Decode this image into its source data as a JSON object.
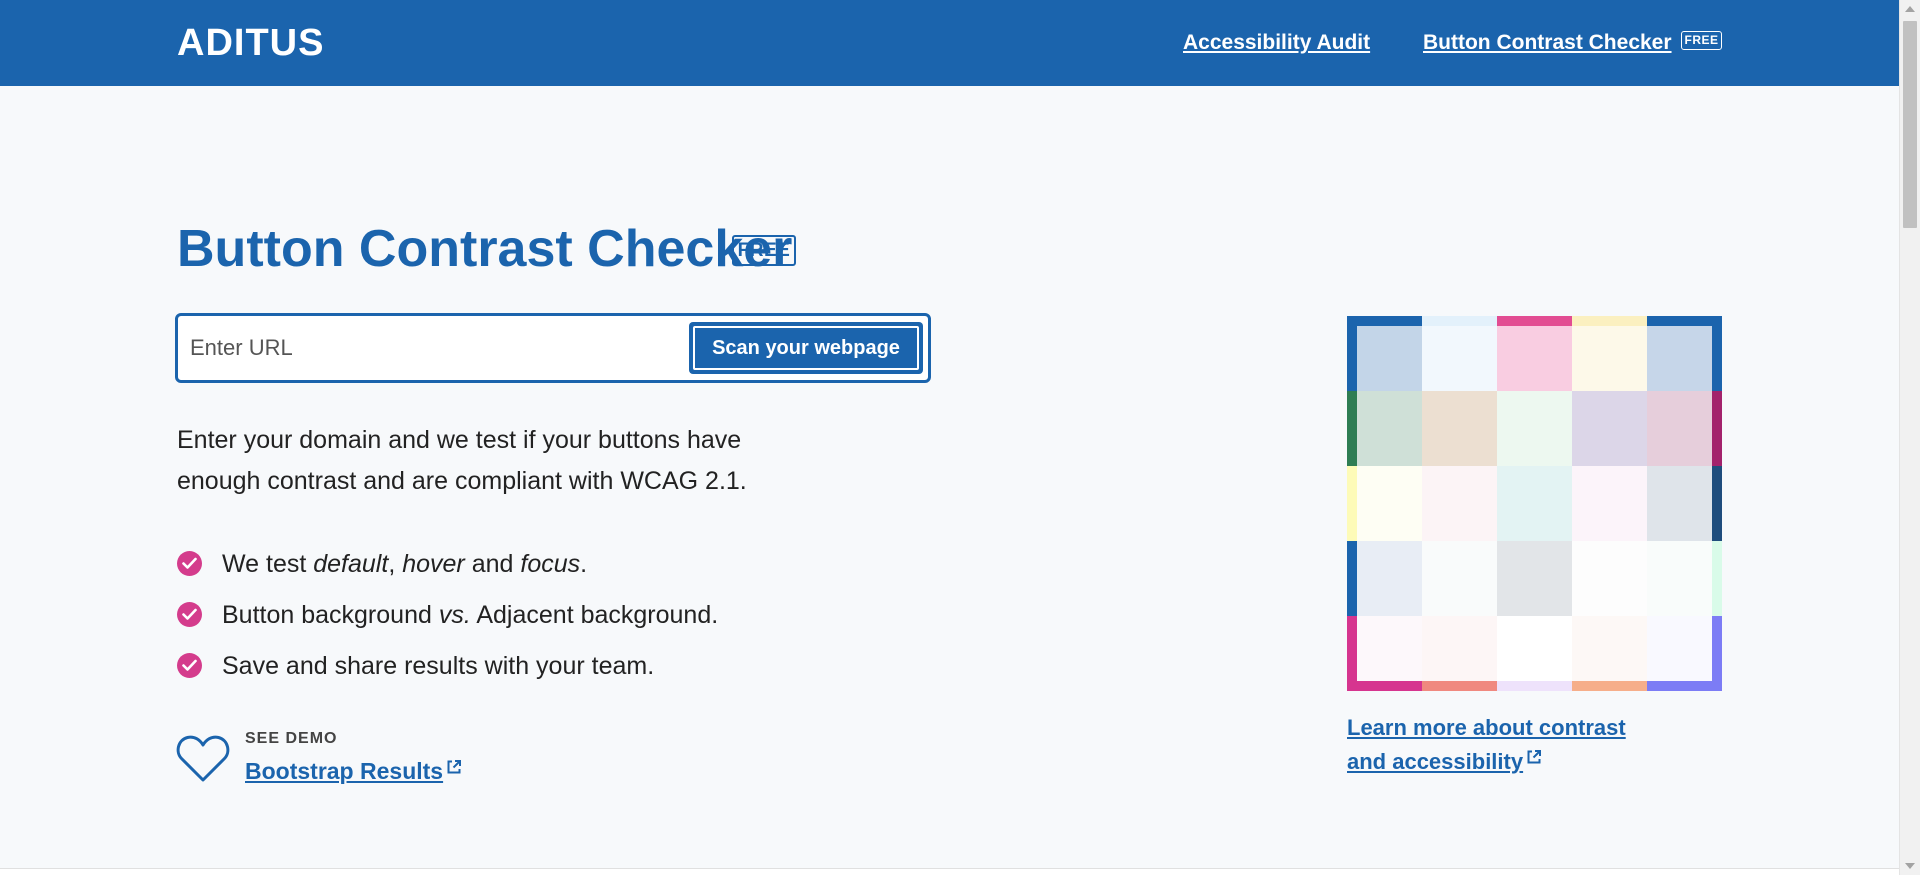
{
  "header": {
    "logo": "ADITUS",
    "nav": [
      {
        "label": "Accessibility Audit"
      },
      {
        "label": "Button Contrast Checker",
        "badge": "FREE"
      }
    ]
  },
  "hero": {
    "title": "Button Contrast Checker",
    "badge": "FREE",
    "url_input": {
      "placeholder": "Enter URL",
      "value": ""
    },
    "scan_button": "Scan your webpage",
    "description": "Enter your domain and we test if your buttons have enough contrast and are compliant with WCAG 2.1."
  },
  "features": [
    {
      "parts": [
        {
          "text": "We test ",
          "italic": false
        },
        {
          "text": "default",
          "italic": true
        },
        {
          "text": ", ",
          "italic": false
        },
        {
          "text": "hover",
          "italic": true
        },
        {
          "text": " and ",
          "italic": false
        },
        {
          "text": "focus",
          "italic": true
        },
        {
          "text": ".",
          "italic": false
        }
      ]
    },
    {
      "parts": [
        {
          "text": "Button background ",
          "italic": false
        },
        {
          "text": "vs.",
          "italic": true
        },
        {
          "text": " Adjacent background.",
          "italic": false
        }
      ]
    },
    {
      "parts": [
        {
          "text": "Save and share results with your team.",
          "italic": false
        }
      ]
    }
  ],
  "demo": {
    "label": "SEE DEMO",
    "link": "Bootstrap Results"
  },
  "sidebar": {
    "learn_link": "Learn more about contrast and accessibility"
  },
  "mosaic": {
    "tiles": [
      [
        "#c3d5e8",
        "#f2f8fd",
        "#f9cde1",
        "#fdf9e9",
        "#c6d6e9"
      ],
      [
        "#cfe0d7",
        "#ecdfd1",
        "#edf8f0",
        "#dcd6e8",
        "#e6cedb"
      ],
      [
        "#fefef4",
        "#fcf4f6",
        "#e3f3f3",
        "#fcf4fa",
        "#dfe4ea"
      ],
      [
        "#e8edf5",
        "#f9fbfb",
        "#e2e5e8",
        "#fdfdfd",
        "#f9fcfb"
      ],
      [
        "#fdf8fb",
        "#fdf6f6",
        "#ffffff",
        "#fdf8f6",
        "#f9f9ff"
      ]
    ],
    "border_top": [
      "#1b64ad",
      "#e3f1fb",
      "#e24c92",
      "#fbf0c0",
      "#1b64ad"
    ],
    "border_bottom": [
      "#d6358f",
      "#f0897f",
      "#eee2fb",
      "#f6ae8a",
      "#7c7cf5"
    ],
    "border_left": [
      "#1b64ad",
      "#2e7d53",
      "#fdfbb8",
      "#1b64ad",
      "#d6358f"
    ],
    "border_right": [
      "#1b64ad",
      "#a3226c",
      "#1f4d7d",
      "#d9fbe9",
      "#7c7cf5"
    ]
  },
  "colors": {
    "brand_blue": "#1b64ad",
    "check_pink": "#d43c8c",
    "page_background": "#f7f9fb"
  }
}
